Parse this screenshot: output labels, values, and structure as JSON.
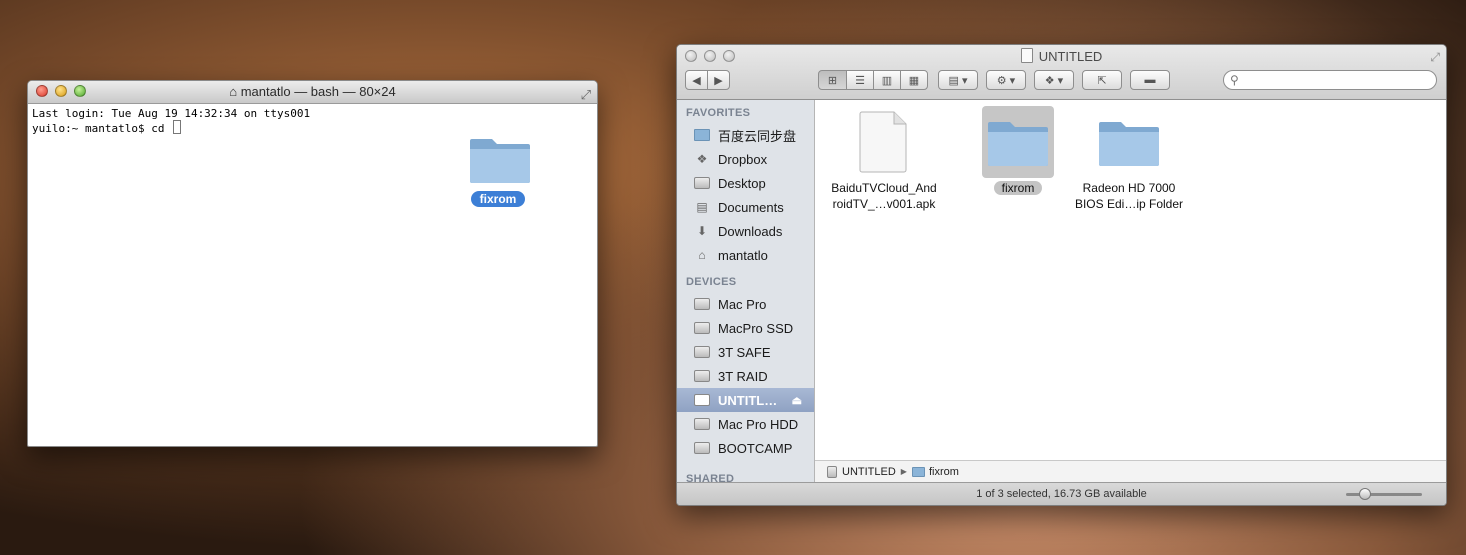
{
  "terminal": {
    "title": "mantatlo — bash — 80×24",
    "line1": "Last login: Tue Aug 19 14:32:34 on ttys001",
    "prompt": "yuilo:~ mantatlo$ cd ",
    "drag_folder_label": "fixrom"
  },
  "finder": {
    "title": "UNTITLED",
    "sidebar": {
      "favorites_header": "FAVORITES",
      "favorites": [
        {
          "label": "百度云同步盘",
          "icon": "folder-icon"
        },
        {
          "label": "Dropbox",
          "icon": "dropbox-icon"
        },
        {
          "label": "Desktop",
          "icon": "desktop-icon"
        },
        {
          "label": "Documents",
          "icon": "documents-icon"
        },
        {
          "label": "Downloads",
          "icon": "downloads-icon"
        },
        {
          "label": "mantatlo",
          "icon": "home-icon"
        }
      ],
      "devices_header": "DEVICES",
      "devices": [
        {
          "label": "Mac Pro",
          "icon": "computer-icon"
        },
        {
          "label": "MacPro SSD",
          "icon": "hard-drive-icon"
        },
        {
          "label": "3T SAFE",
          "icon": "hard-drive-icon"
        },
        {
          "label": "3T RAID",
          "icon": "hard-drive-icon"
        },
        {
          "label": "UNTITL…",
          "icon": "drive-icon",
          "selected": true
        },
        {
          "label": "Mac Pro HDD",
          "icon": "hard-drive-icon"
        },
        {
          "label": "BOOTCAMP",
          "icon": "hard-drive-icon"
        }
      ],
      "shared_header": "SHARED"
    },
    "files": [
      {
        "name_line1": "BaiduTVCloud_And",
        "name_line2": "roidTV_…v001.apk",
        "icon": "document-icon"
      },
      {
        "name_line1": "fixrom",
        "name_line2": "",
        "icon": "folder-icon",
        "selected": true
      },
      {
        "name_line1": "Radeon HD 7000",
        "name_line2": "BIOS Edi…ip Folder",
        "icon": "folder-icon"
      }
    ],
    "path": [
      "UNTITLED",
      "fixrom"
    ],
    "status": "1 of 3 selected, 16.73 GB available",
    "zoom_level": 0.2
  },
  "colors": {
    "selection_blue": "#3d7fd6",
    "folder_blue": "#8bb4d8",
    "sidebar_bg": "#dfe3e8"
  }
}
